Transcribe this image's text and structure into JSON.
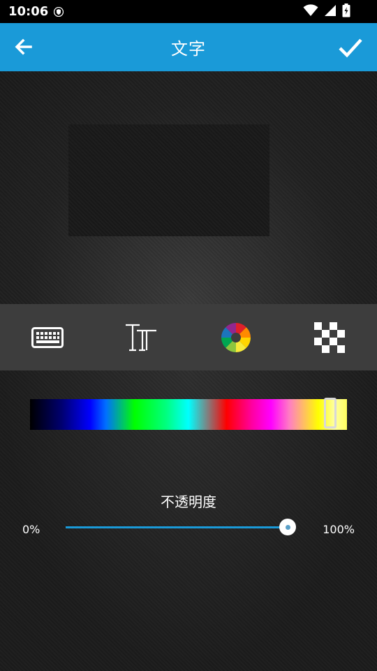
{
  "status": {
    "time": "10:06"
  },
  "appbar": {
    "title": "文字"
  },
  "icons": {
    "back": "arrow-left-icon",
    "confirm": "check-icon",
    "keyboard": "keyboard-icon",
    "font": "font-size-icon",
    "color": "color-wheel-icon",
    "opacity": "checkerboard-icon"
  },
  "colors": {
    "accent": "#1a9ad8",
    "toolbar": "#3d3d3d"
  },
  "color_picker": {
    "selected_position": 0.965
  },
  "opacity": {
    "label": "不透明度",
    "min_label": "0%",
    "max_label": "100%",
    "value": 100
  }
}
